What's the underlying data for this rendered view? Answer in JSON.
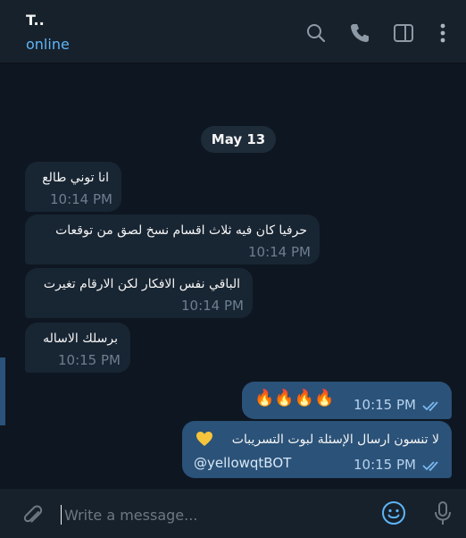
{
  "header": {
    "title": "T..",
    "status": "online",
    "icons": [
      "search-icon",
      "phone-icon",
      "sidebar-toggle-icon",
      "more-vertical-icon"
    ]
  },
  "chat": {
    "date_label": "May 13",
    "incoming": [
      {
        "text": "انا توني طالع",
        "time": "10:14 PM"
      },
      {
        "text": "حرفيا كان فيه ثلاث اقسام نسخ لصق من توقعات",
        "time": "10:14 PM"
      },
      {
        "text": "الباقي نفس الافكار لكن الارقام تغيرت",
        "time": "10:14 PM"
      },
      {
        "text": "برسلك الاساله",
        "time": "10:15 PM"
      }
    ],
    "outgoing": [
      {
        "text": "🔥🔥🔥🔥",
        "time": "10:15 PM",
        "status": "read"
      },
      {
        "text": "لا تنسون ارسال الإسئلة لبوت التسريبات",
        "link": "@yellowqtBOT",
        "time": "10:15 PM",
        "status": "read"
      }
    ]
  },
  "composer": {
    "placeholder": "Write a message...",
    "icons": [
      "attach-icon",
      "emoji-icon",
      "microphone-icon"
    ]
  },
  "colors": {
    "background": "#0e1621",
    "header": "#17212b",
    "incoming_bubble": "#182533",
    "outgoing_bubble": "#2b5278",
    "accent": "#5eb5f7"
  }
}
